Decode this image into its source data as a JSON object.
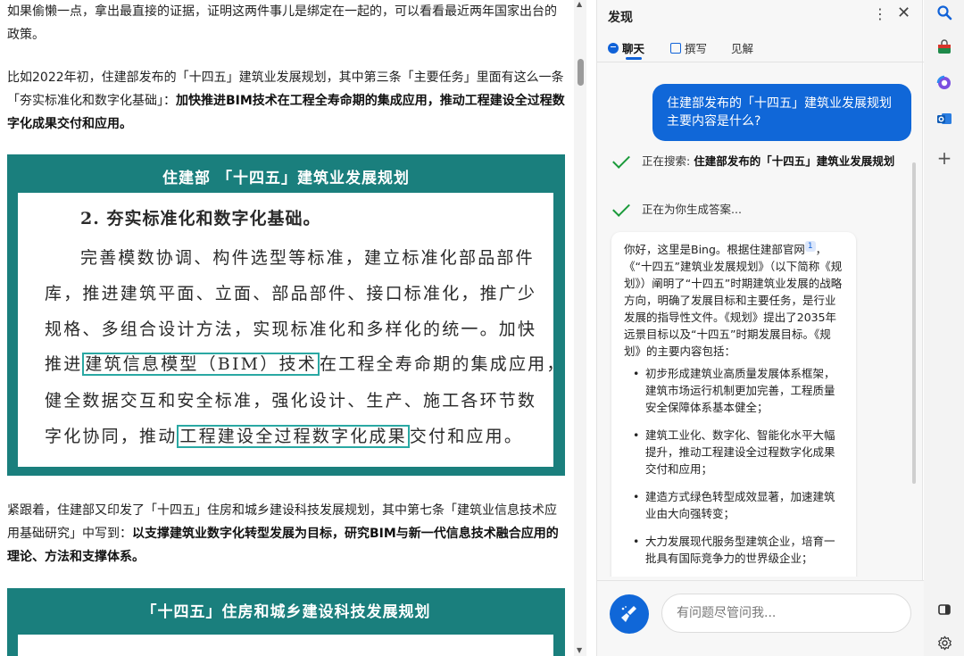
{
  "article": {
    "p1": "如果偷懒一点，拿出最直接的证据，证明这两件事儿是绑定在一起的，可以看看最近两年国家出台的政策。",
    "p2_text": "比如2022年初，住建部发布的「十四五」建筑业发展规划，其中第三条「主要任务」里面有这么一条「夯实标准化和数字化基础」：",
    "p2_bold": "加快推进BIM技术在工程全寿命期的集成应用，推动工程建设全过程数字化成果交付和应用。",
    "banner1": "住建部 「十四五」建筑业发展规划",
    "doc_heading": "2. 夯实标准化和数字化基础。",
    "doc_lines": [
      "完善模数协调、构件选型等标准，建立标准化部品部件",
      "库，推进建筑平面、立面、部品部件、接口标准化，推广少",
      "规格、多组合设计方法，实现标准化和多样化的统一。加快",
      "推进",
      "建筑信息模型（BIM）技术",
      "在工程全寿命期的集成应用，",
      "健全数据交互和安全标准，强化设计、生产、施工各环节数",
      "字化协同，推动",
      "工程建设全过程数字化成果",
      "交付和应用。"
    ],
    "p3_text": "紧跟着，住建部又印发了「十四五」住房和城乡建设科技发展规划，其中第七条「建筑业信息技术应用基础研究」中写到：",
    "p3_bold": "以支撑建筑业数字化转型发展为目标，研究BIM与新一代信息技术融合应用的理论、方法和支撑体系。",
    "banner2": "「十四五」住房和城乡建设科技发展规划"
  },
  "panel": {
    "title": "发现",
    "more": "⋮",
    "close": "✕",
    "tabs": [
      "聊天",
      "撰写",
      "见解"
    ],
    "user_message": "住建部发布的「十四五」建筑业发展规划主要内容是什么?",
    "status_search_prefix": "正在搜索: ",
    "status_search_query": "住建部发布的「十四五」建筑业发展规划",
    "status_generating": "正在为你生成答案...",
    "answer_intro_a": "你好，这里是Bing。根据住建部官网",
    "answer_cite": "1",
    "answer_intro_b": "，《“十四五”建筑业发展规划》（以下简称《规划》）阐明了“十四五”时期建筑业发展的战略方向，明确了发展目标和主要任务，是行业发展的指导性文件。《规划》提出了2035年远景目标以及“十四五”时期发展目标。《规划》的主要内容包括：",
    "bullets": [
      "初步形成建筑业高质量发展体系框架，建筑市场运行机制更加完善，工程质量安全保障体系基本健全；",
      "建筑工业化、数字化、智能化水平大幅提升，推动工程建设全过程数字化成果交付和应用；",
      "建造方式绿色转型成效显著，加速建筑业由大向强转变；",
      "大力发展现代服务型建筑企业，培育一批具有国际竞争力的世界级企业；"
    ],
    "input_placeholder": "有问题尽管问我..."
  },
  "rail": {
    "plus": "+"
  },
  "colors": {
    "accent_blue": "#1067d8",
    "banner_teal": "#1a7f7d",
    "highlight_teal": "#2aa8a3",
    "check_green": "#1a9a3a"
  }
}
